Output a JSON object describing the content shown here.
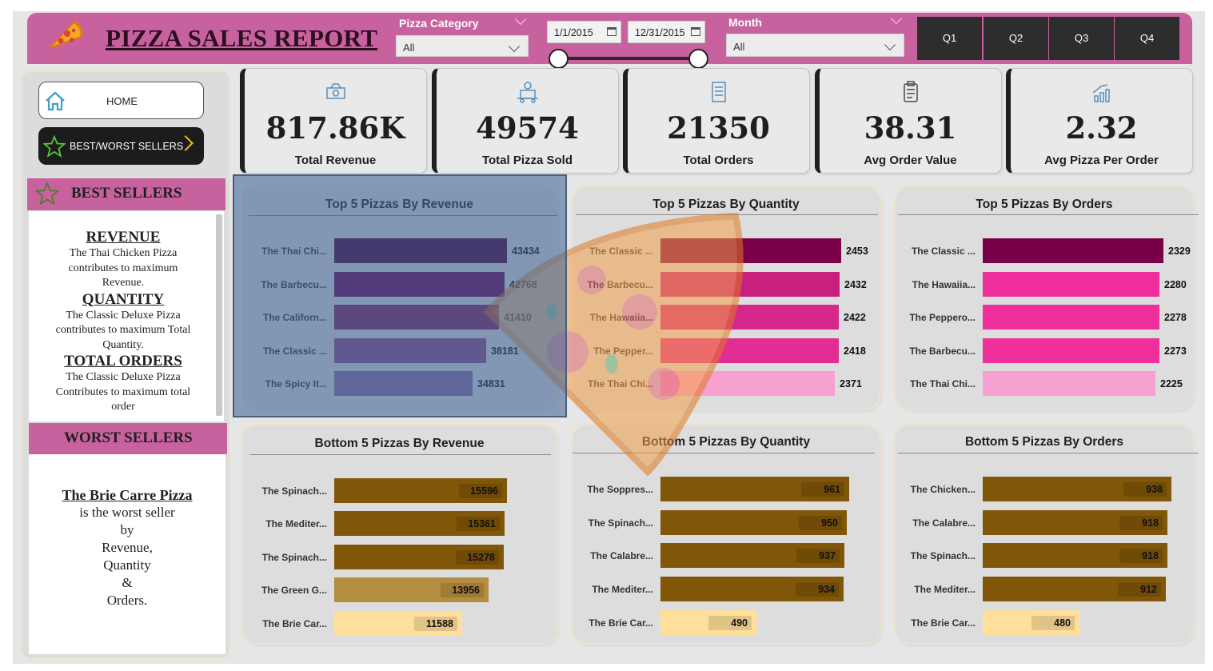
{
  "title": "PIZZA SALES REPORT",
  "filters": {
    "category_label": "Pizza Category",
    "category_value": "All",
    "start_date": "1/1/2015",
    "end_date": "12/31/2015",
    "month_label": "Month",
    "month_value": "All",
    "quarters": [
      "Q1",
      "Q2",
      "Q3",
      "Q4"
    ]
  },
  "nav": {
    "home": "HOME",
    "best_worst": "BEST/WORST SELLERS"
  },
  "best_sellers": {
    "heading": "BEST SELLERS",
    "revenue_title": "REVENUE",
    "revenue_text": "The Thai Chicken Pizza contributes to maximum Revenue.",
    "quantity_title": "QUANTITY",
    "quantity_text": "The Classic Deluxe Pizza contributes to maximum Total Quantity.",
    "orders_title": "TOTAL ORDERS",
    "orders_text": "The Classic Deluxe Pizza Contributes to maximum total order"
  },
  "worst_sellers": {
    "heading": "WORST SELLERS",
    "pizza": "The Brie Carre Pizza",
    "line1": "is the worst seller",
    "line2": "by",
    "line3": "Revenue,",
    "line4": "Quantity",
    "line5": "&",
    "line6": "Orders."
  },
  "kpis": [
    {
      "value": "817.86K",
      "label": "Total Revenue",
      "icon": "money-icon"
    },
    {
      "value": "49574",
      "label": "Total Pizza Sold",
      "icon": "delivery-icon"
    },
    {
      "value": "21350",
      "label": "Total Orders",
      "icon": "order-list-icon"
    },
    {
      "value": "38.31",
      "label": "Avg Order Value",
      "icon": "clipboard-icon"
    },
    {
      "value": "2.32",
      "label": "Avg Pizza Per Order",
      "icon": "growth-chart-icon"
    }
  ],
  "colors": {
    "header": "#c8629f",
    "top_revenue": [
      "#4a0038",
      "#6b0057",
      "#832060",
      "#8e4a86",
      "#8a6ba0"
    ],
    "top_quantity": [
      "#7a0049",
      "#c7207f",
      "#d6278a",
      "#e32d93",
      "#f7a1d2"
    ],
    "top_orders": [
      "#780048",
      "#ee2f9c",
      "#ee2f9c",
      "#ee2f9c",
      "#f7a1d2"
    ],
    "bottom": "#805608",
    "bottom_mid": "#b58d40",
    "bottom_light": "#ffdf9a"
  },
  "chart_data": [
    {
      "type": "bar",
      "title": "Top 5 Pizzas By Revenue",
      "categories": [
        "The Thai Chi...",
        "The Barbecu...",
        "The Californ...",
        "The Classic ...",
        "The Spicy It..."
      ],
      "values": [
        43434,
        42768,
        41410,
        38181,
        34831
      ]
    },
    {
      "type": "bar",
      "title": "Top 5 Pizzas By Quantity",
      "categories": [
        "The Classic ...",
        "The Barbecu...",
        "The Hawaiia...",
        "The Pepper...",
        "The Thai Chi..."
      ],
      "values": [
        2453,
        2432,
        2422,
        2418,
        2371
      ]
    },
    {
      "type": "bar",
      "title": "Top 5 Pizzas By Orders",
      "categories": [
        "The Classic ...",
        "The Hawaiia...",
        "The Peppero...",
        "The Barbecu...",
        "The Thai Chi..."
      ],
      "values": [
        2329,
        2280,
        2278,
        2273,
        2225
      ]
    },
    {
      "type": "bar",
      "title": "Bottom 5 Pizzas By Revenue",
      "categories": [
        "The Spinach...",
        "The Mediter...",
        "The Spinach...",
        "The Green G...",
        "The Brie Car..."
      ],
      "values": [
        15596,
        15361,
        15278,
        13956,
        11588
      ]
    },
    {
      "type": "bar",
      "title": "Bottom 5 Pizzas By Quantity",
      "categories": [
        "The Soppres...",
        "The Spinach...",
        "The Calabre...",
        "The Mediter...",
        "The Brie Car..."
      ],
      "values": [
        961,
        950,
        937,
        934,
        490
      ]
    },
    {
      "type": "bar",
      "title": "Bottom 5 Pizzas By Orders",
      "categories": [
        "The Chicken...",
        "The Calabre...",
        "The Spinach...",
        "The Mediter...",
        "The Brie Car..."
      ],
      "values": [
        938,
        918,
        918,
        912,
        480
      ]
    }
  ]
}
